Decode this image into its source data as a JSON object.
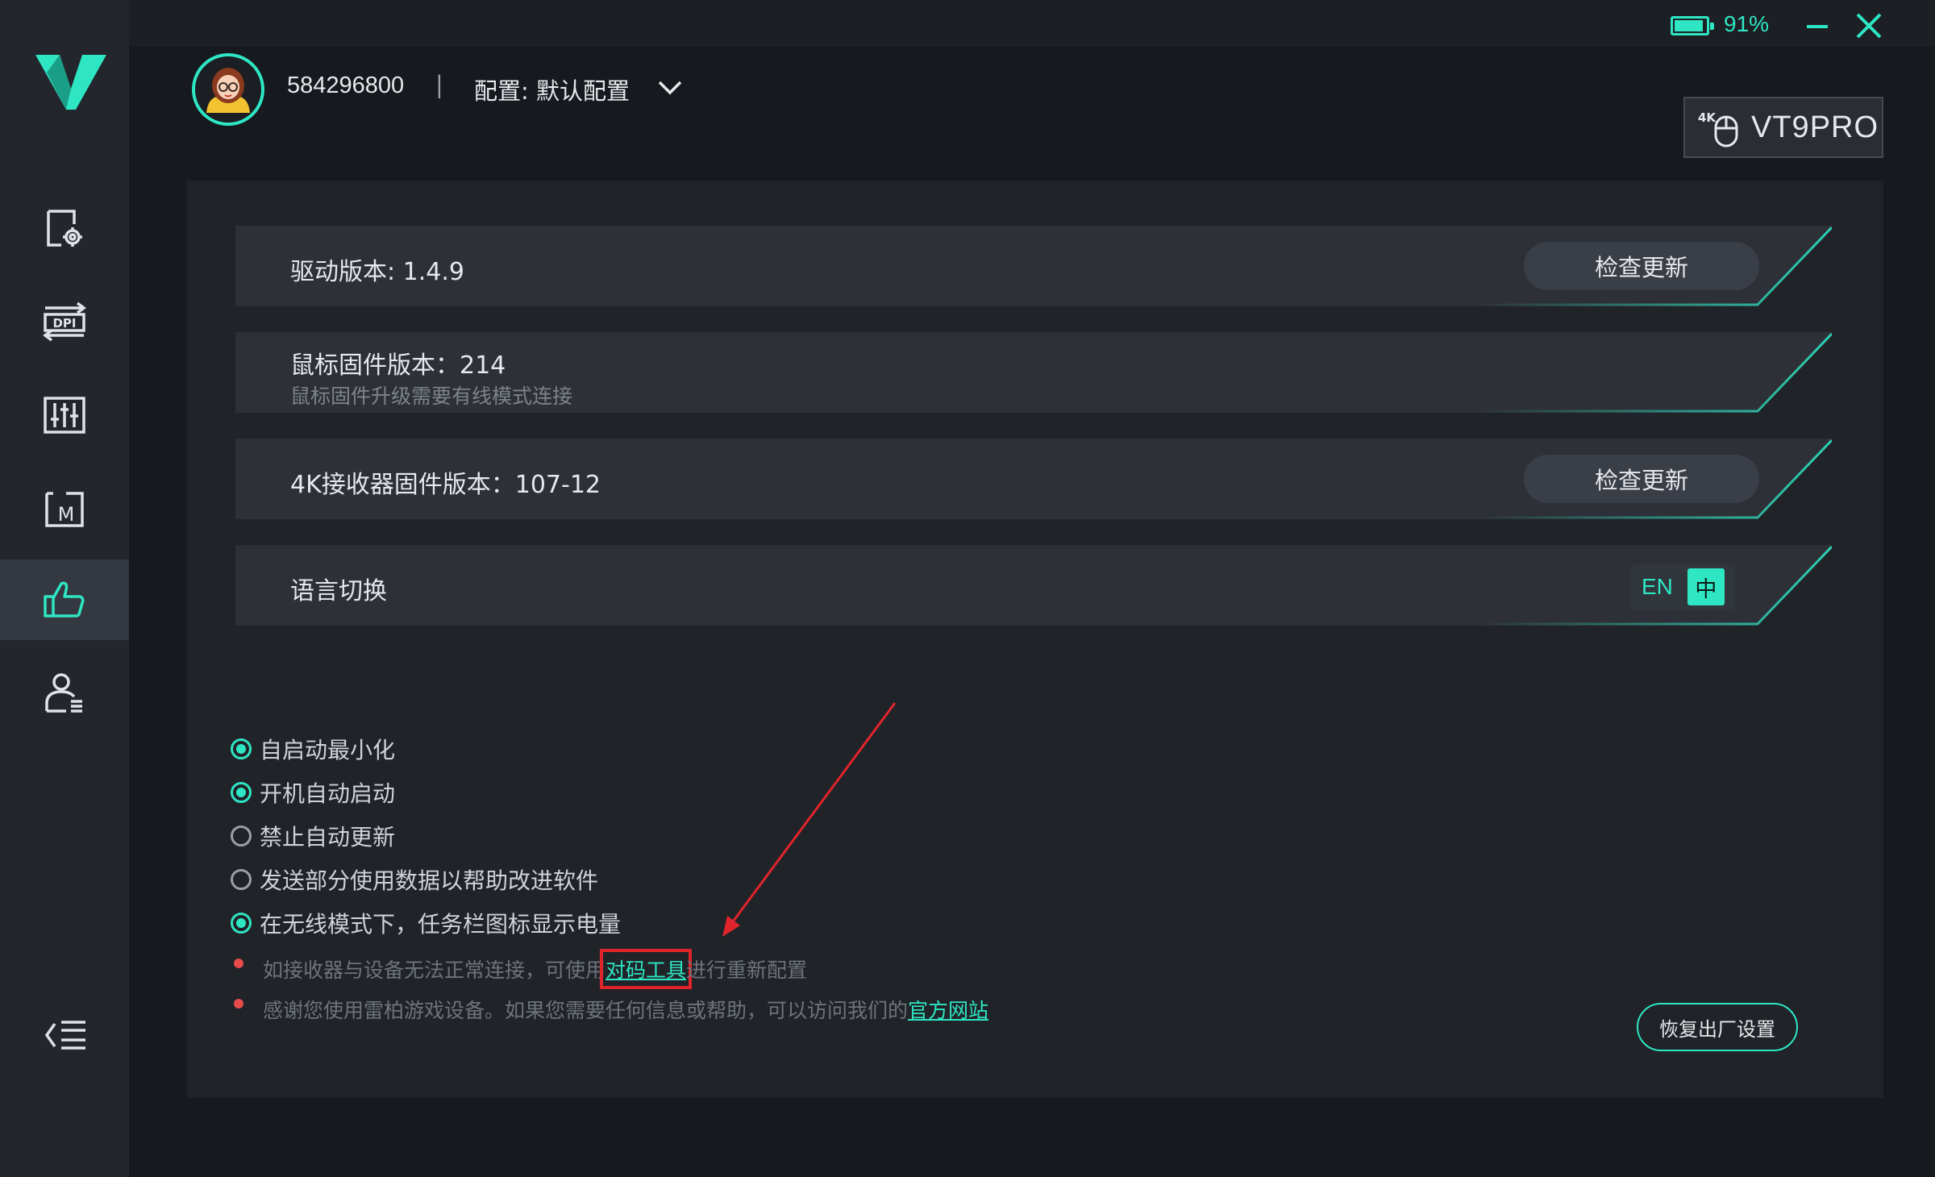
{
  "app": {
    "battery_pct": 91,
    "battery_label": "91%"
  },
  "header": {
    "user_id": "584296800",
    "separator": "|",
    "config_label": "配置: 默认配置",
    "device_model": "VT9PRO",
    "device_badge_prefix": "4K"
  },
  "sidebar": {
    "items": [
      {
        "icon": "screen-settings-icon"
      },
      {
        "icon": "dpi-icon",
        "label": "DPI"
      },
      {
        "icon": "sliders-icon"
      },
      {
        "icon": "macro-icon",
        "label": "M"
      },
      {
        "icon": "thumbs-up-icon",
        "active": true
      },
      {
        "icon": "user-list-icon"
      }
    ]
  },
  "rows": [
    {
      "title": "驱动版本: 1.4.9",
      "button": "检查更新"
    },
    {
      "title": "鼠标固件版本：214",
      "subtitle": "鼠标固件升级需要有线模式连接"
    },
    {
      "title": "4K接收器固件版本：107-12",
      "button": "检查更新"
    },
    {
      "title": "语言切换",
      "lang_en": "EN",
      "lang_zh": "中",
      "selected": "中"
    }
  ],
  "options": [
    {
      "label": "自启动最小化",
      "checked": true
    },
    {
      "label": "开机自动启动",
      "checked": true
    },
    {
      "label": "禁止自动更新",
      "checked": false
    },
    {
      "label": "发送部分使用数据以帮助改进软件",
      "checked": false
    },
    {
      "label": "在无线模式下，任务栏图标显示电量",
      "checked": true
    }
  ],
  "notes": {
    "pairing_before": "如接收器与设备无法正常连接，可使用",
    "pairing_link": "对码工具",
    "pairing_after": "进行重新配置",
    "thanks_before": "感谢您使用雷柏游戏设备。如果您需要任何信息或帮助，可以访问我们的",
    "thanks_link": "官方网站"
  },
  "reset_button": "恢复出厂设置",
  "colors": {
    "accent": "#2ee6c4",
    "annotation": "#e0242b",
    "background": "#16191e",
    "panel": "#202328"
  }
}
